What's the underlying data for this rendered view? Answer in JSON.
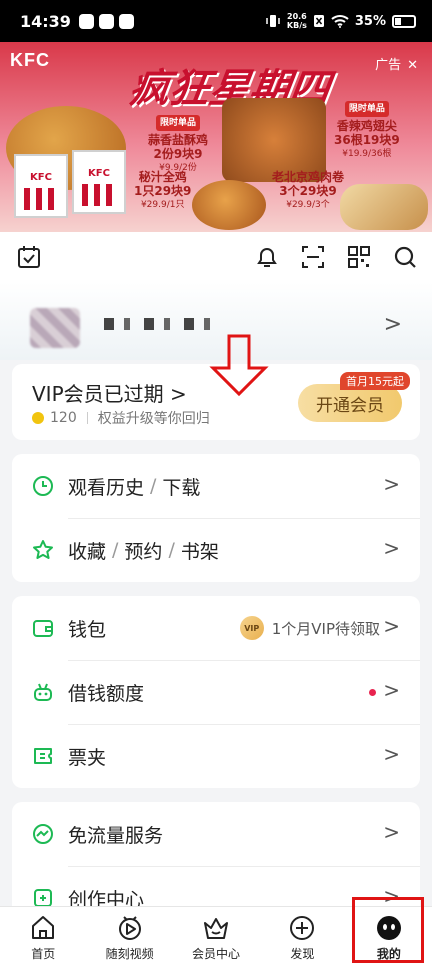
{
  "status_bar": {
    "time": "14:39",
    "net_speed_value": "20.6",
    "net_speed_unit": "KB/s",
    "battery": "35%"
  },
  "banner": {
    "logo": "KFC",
    "title": "疯狂星期四",
    "ad_label": "广告",
    "promos": [
      {
        "tag": "限时单品",
        "line1": "蒜香盐酥鸡",
        "line2": "2份9块9",
        "line3": "¥9.9/2份"
      },
      {
        "tag": "限时单品",
        "line1": "香辣鸡翅尖",
        "line2": "36根19块9",
        "line3": "¥19.9/36根"
      },
      {
        "tag": "",
        "line1": "秘汁全鸡",
        "line2": "1只29块9",
        "line3": "¥29.9/1只"
      },
      {
        "tag": "",
        "line1": "老北京鸡肉卷",
        "line2": "3个29块9",
        "line3": "¥29.9/3个"
      }
    ]
  },
  "toolbar": {
    "icons": [
      "calendar-check-icon",
      "bell-icon",
      "scan-icon",
      "qr-code-icon",
      "search-icon"
    ]
  },
  "vip": {
    "title": "VIP会员已过期",
    "title_arrow": ">",
    "points": "120",
    "subtitle": "权益升级等你回归",
    "button_label": "开通会员",
    "badge": "首月15元起"
  },
  "menu_group_1": [
    {
      "parts": [
        "观看历史",
        "下载"
      ],
      "icon": "clock-icon"
    },
    {
      "parts": [
        "收藏",
        "预约",
        "书架"
      ],
      "icon": "star-icon"
    }
  ],
  "menu_group_2": [
    {
      "label": "钱包",
      "icon": "wallet-icon",
      "right_text": "1个月VIP待领取",
      "vip_chip": "VIP"
    },
    {
      "label": "借钱额度",
      "icon": "robot-icon",
      "red_dot": true
    },
    {
      "label": "票夹",
      "icon": "ticket-icon"
    }
  ],
  "menu_group_3": [
    {
      "label": "免流量服务",
      "icon": "flow-icon"
    },
    {
      "label": "创作中心",
      "icon": "create-icon"
    }
  ],
  "separator": "/",
  "chevron": ">",
  "bottom_nav": [
    {
      "label": "首页",
      "icon": "home-icon"
    },
    {
      "label": "随刻视频",
      "icon": "video-icon"
    },
    {
      "label": "会员中心",
      "icon": "crown-icon"
    },
    {
      "label": "发现",
      "icon": "plus-icon"
    },
    {
      "label": "我的",
      "icon": "profile-face-icon",
      "active": true
    }
  ],
  "colors": {
    "accent_green": "#1db954",
    "annotation_red": "#e01414",
    "vip_gold": "#f1c96d"
  }
}
